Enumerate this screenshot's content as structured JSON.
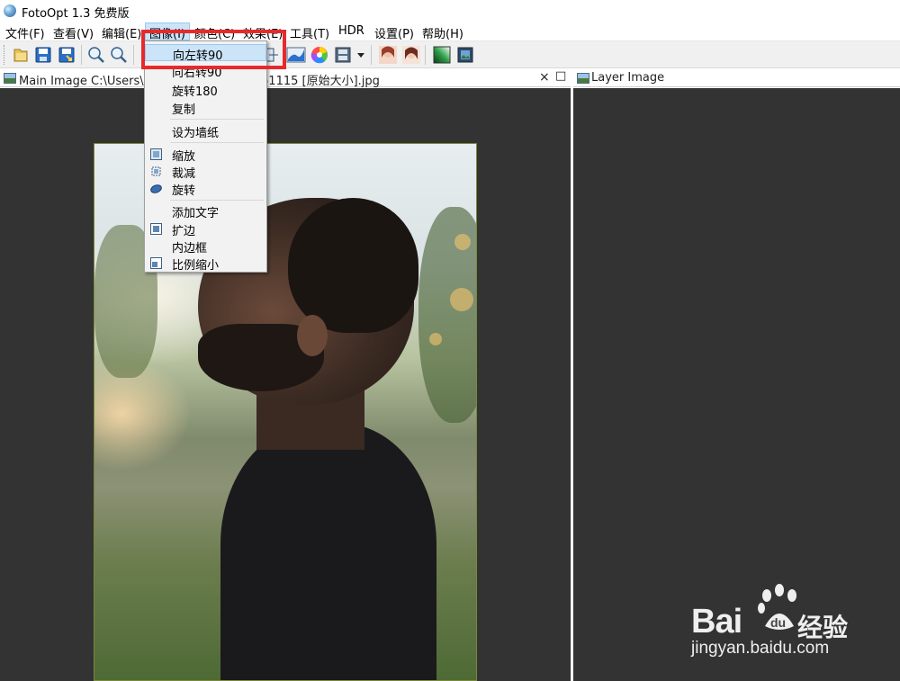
{
  "window": {
    "title": "FotoOpt 1.3 免费版",
    "app_icon": "fotoopt-app-icon"
  },
  "menubar": {
    "items": [
      {
        "label": "文件(F)"
      },
      {
        "label": "查看(V)"
      },
      {
        "label": "编辑(E)"
      },
      {
        "label": "图像(I)",
        "active": true
      },
      {
        "label": "颜色(C)"
      },
      {
        "label": "效果(E)"
      },
      {
        "label": "工具(T)"
      },
      {
        "label": "HDR"
      },
      {
        "label": "设置(P)"
      },
      {
        "label": "帮助(H)"
      }
    ]
  },
  "toolbar": {
    "buttons": [
      {
        "icon": "open-folder-icon"
      },
      {
        "icon": "save-icon"
      },
      {
        "icon": "save-as-icon"
      },
      {
        "icon": "zoom-in-icon"
      },
      {
        "icon": "zoom-out-icon"
      },
      {
        "icon": "resize-icon"
      },
      {
        "icon": "levels-icon"
      },
      {
        "icon": "color-wheel-icon"
      },
      {
        "icon": "film-strip-icon"
      },
      {
        "icon": "dropdown-arrow-icon"
      },
      {
        "icon": "portrait-effect-icon"
      },
      {
        "icon": "portrait-effect-2-icon"
      },
      {
        "icon": "gradient-icon"
      },
      {
        "icon": "image-layer-icon"
      }
    ]
  },
  "main_pane": {
    "title": "Main Image C:\\Users\\9...2\\pexels-photo-761115 [原始大小].jpg",
    "close_label": "×",
    "restore_label": "□"
  },
  "layer_pane": {
    "title": "Layer Image"
  },
  "image_menu": {
    "items": [
      {
        "label": "向左转90",
        "highlighted": true,
        "icon": null
      },
      {
        "label": "向右转90",
        "icon": null
      },
      {
        "label": "旋转180",
        "icon": null
      },
      {
        "label": "复制",
        "icon": null
      },
      {
        "label": "设为墙纸",
        "icon": null,
        "separator_before": true
      },
      {
        "label": "缩放",
        "icon": "scale-icon",
        "separator_before": true
      },
      {
        "label": "裁减",
        "icon": "crop-icon"
      },
      {
        "label": "旋转",
        "icon": "rotate-icon"
      },
      {
        "label": "添加文字",
        "icon": null,
        "separator_before": true
      },
      {
        "label": "扩边",
        "icon": "expand-border-icon"
      },
      {
        "label": "内边框",
        "icon": null
      },
      {
        "label": "比例缩小",
        "icon": "proportional-shrink-icon"
      }
    ]
  },
  "annotation": {
    "color": "#e8292b",
    "target": "向左转90"
  },
  "watermark": {
    "brand_latin": "Bai",
    "brand_paw": "du",
    "brand_cn": "经验",
    "url": "jingyan.baidu.com"
  },
  "colors": {
    "workspace": "#333333",
    "menu_highlight": "#cce4f7",
    "annotation_red": "#e8292b"
  }
}
